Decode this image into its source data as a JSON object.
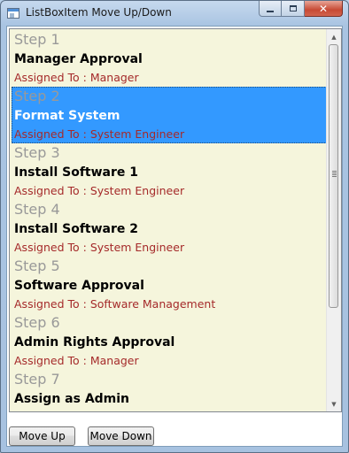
{
  "window": {
    "title": "ListBoxItem Move Up/Down",
    "close_glyph": "✕"
  },
  "list": {
    "items": [
      {
        "step": "Step 1",
        "name": "Manager Approval",
        "assigned": "Assigned To : Manager",
        "selected": false
      },
      {
        "step": "Step 2",
        "name": "Format System",
        "assigned": "Assigned To : System Engineer",
        "selected": true
      },
      {
        "step": "Step 3",
        "name": "Install Software 1",
        "assigned": "Assigned To : System Engineer",
        "selected": false
      },
      {
        "step": "Step 4",
        "name": "Install Software 2",
        "assigned": "Assigned To : System Engineer",
        "selected": false
      },
      {
        "step": "Step 5",
        "name": "Software Approval",
        "assigned": "Assigned To : Software Management",
        "selected": false
      },
      {
        "step": "Step 6",
        "name": "Admin Rights Approval",
        "assigned": "Assigned To : Manager",
        "selected": false
      },
      {
        "step": "Step 7",
        "name": "Assign as Admin",
        "assigned": "",
        "selected": false
      }
    ]
  },
  "buttons": {
    "move_up": "Move Up",
    "move_down": "Move Down"
  },
  "colors": {
    "list_background": "#f5f5dc",
    "selection": "#3399ff",
    "step_text": "#999999",
    "assigned_text": "#a52a2a"
  },
  "icons": {
    "app": "app-window-icon",
    "minimize": "minimize-icon",
    "maximize": "maximize-icon",
    "close": "close-icon",
    "scroll_up": "scroll-up-arrow-icon",
    "scroll_down": "scroll-down-arrow-icon"
  }
}
